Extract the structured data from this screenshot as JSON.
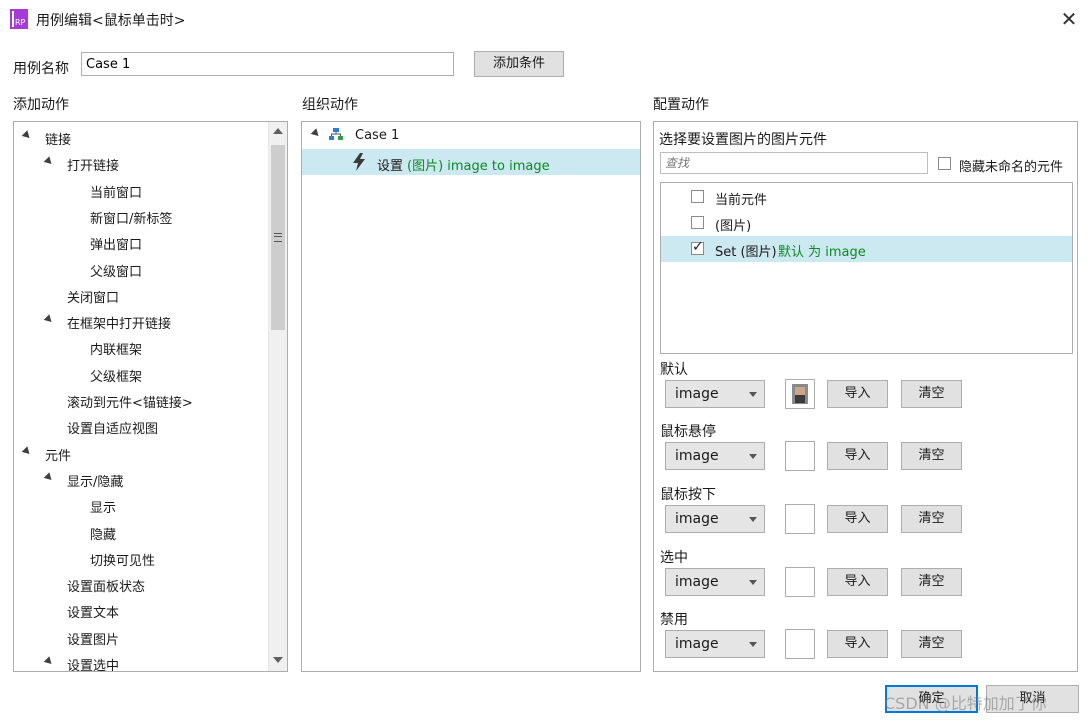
{
  "window": {
    "title": "用例编辑<鼠标单击时>",
    "app_icon": "axure-rp-icon",
    "app_icon_text": "RP",
    "close_label": "✕"
  },
  "case": {
    "name_label": "用例名称",
    "name_value": "Case 1",
    "add_condition_label": "添加条件"
  },
  "left": {
    "heading": "添加动作",
    "tree": [
      {
        "label": "链接",
        "level": 0,
        "expanded": true
      },
      {
        "label": "打开链接",
        "level": 1,
        "expanded": true
      },
      {
        "label": "当前窗口",
        "level": 2
      },
      {
        "label": "新窗口/新标签",
        "level": 2
      },
      {
        "label": "弹出窗口",
        "level": 2
      },
      {
        "label": "父级窗口",
        "level": 2
      },
      {
        "label": "关闭窗口",
        "level": 1
      },
      {
        "label": "在框架中打开链接",
        "level": 1,
        "expanded": true
      },
      {
        "label": "内联框架",
        "level": 2
      },
      {
        "label": "父级框架",
        "level": 2
      },
      {
        "label": "滚动到元件<锚链接>",
        "level": 1
      },
      {
        "label": "设置自适应视图",
        "level": 1
      },
      {
        "label": "元件",
        "level": 0,
        "expanded": true
      },
      {
        "label": "显示/隐藏",
        "level": 1,
        "expanded": true
      },
      {
        "label": "显示",
        "level": 2
      },
      {
        "label": "隐藏",
        "level": 2
      },
      {
        "label": "切换可见性",
        "level": 2
      },
      {
        "label": "设置面板状态",
        "level": 1
      },
      {
        "label": "设置文本",
        "level": 1
      },
      {
        "label": "设置图片",
        "level": 1
      },
      {
        "label": "设置选中",
        "level": 1,
        "expanded": true
      }
    ]
  },
  "middle": {
    "heading": "组织动作",
    "case_label": "Case 1",
    "action_prefix": "设置",
    "action_detail": "(图片) image to image"
  },
  "right": {
    "heading": "配置动作",
    "select_label": "选择要设置图片的图片元件",
    "search_placeholder": "查找",
    "hide_unnamed_label": "隐藏未命名的元件",
    "widgets": [
      {
        "label": "当前元件",
        "checked": false
      },
      {
        "label": "(图片)",
        "checked": false
      },
      {
        "label": "Set (图片)",
        "suffix": "默认 为 image",
        "checked": true
      }
    ],
    "states": [
      {
        "label": "默认",
        "value": "image",
        "has_thumb": true
      },
      {
        "label": "鼠标悬停",
        "value": "image",
        "has_thumb": false
      },
      {
        "label": "鼠标按下",
        "value": "image",
        "has_thumb": false
      },
      {
        "label": "选中",
        "value": "image",
        "has_thumb": false
      },
      {
        "label": "禁用",
        "value": "image",
        "has_thumb": false
      }
    ],
    "import_label": "导入",
    "clear_label": "清空"
  },
  "footer": {
    "ok_label": "确定",
    "cancel_label": "取消",
    "watermark": "CSDN @比特加加了你"
  },
  "colors": {
    "accent": "#0078d7",
    "selection": "#cce8f0",
    "green_text": "#0b8a24",
    "app_icon": "#a63ad6"
  }
}
